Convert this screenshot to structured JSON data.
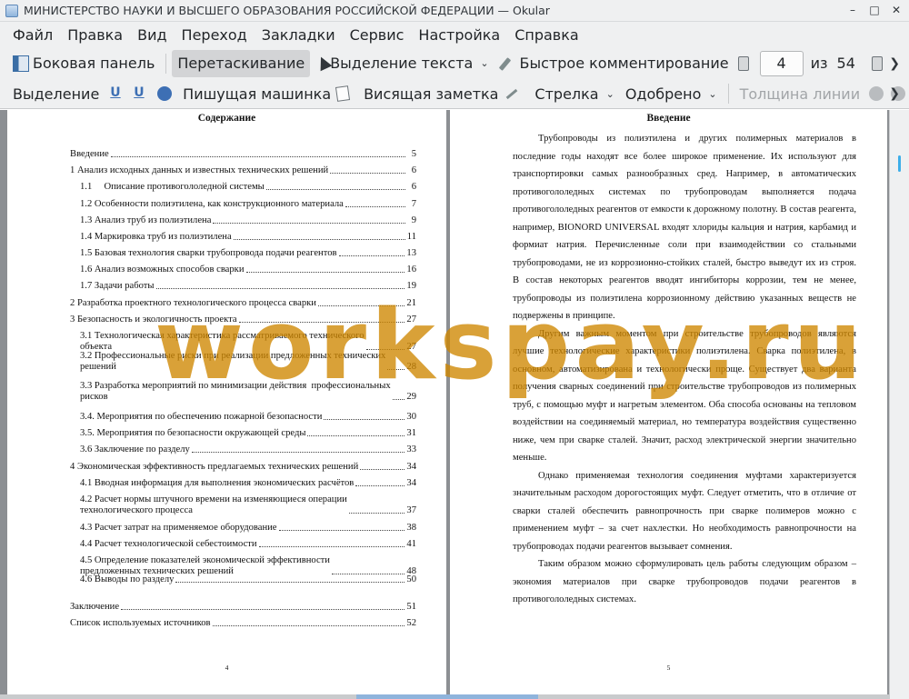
{
  "window": {
    "title": "МИНИСТЕРСТВО НАУКИ И ВЫСШЕГО ОБРАЗОВАНИЯ  РОССИЙСКОЙ ФЕДЕРАЦИИ — Okular",
    "app_icon": "okular-icon",
    "controls": [
      "minimize-icon",
      "maximize-icon",
      "close-icon"
    ]
  },
  "menubar": {
    "items": [
      "Файл",
      "Правка",
      "Вид",
      "Переход",
      "Закладки",
      "Сервис",
      "Настройка",
      "Справка"
    ]
  },
  "toolbar1": {
    "sidebar_label": "Боковая панель",
    "browse_label": "Перетаскивание",
    "text_select_label": "Выделение текста",
    "quick_annot_label": "Быстрое комментирование",
    "page_current": "4",
    "page_of": "из",
    "page_total": "54"
  },
  "toolbar2": {
    "selection_label": "Выделение",
    "typewriter_label": "Пишущая машинка",
    "popup_note_label": "Висящая заметка",
    "arrow_label": "Стрелка",
    "stamp_label": "Одобрено",
    "line_width_label": "Толщина линии"
  },
  "left_page": {
    "heading": "Содержание",
    "page_number": "4",
    "toc": [
      {
        "label": "Введение",
        "page": "5"
      },
      {
        "label": "1 Анализ исходных данных и известных технических решений",
        "page": "6"
      },
      {
        "label": "1.1     Описание противогололедной системы",
        "page": "6"
      },
      {
        "label": "1.2 Особенности полиэтилена, как конструкционного материала",
        "page": "7"
      },
      {
        "label": "1.3 Анализ труб из полиэтилена",
        "page": "9"
      },
      {
        "label": "1.4 Маркировка труб из полиэтилена",
        "page": "11"
      },
      {
        "label": "1.5 Базовая технология сварки трубопровода подачи реагентов",
        "page": "13"
      },
      {
        "label": "1.6 Анализ возможных способов сварки",
        "page": "16"
      },
      {
        "label": "1.7 Задачи работы",
        "page": "19"
      },
      {
        "label": "2 Разработка проектного технологического процесса сварки",
        "page": "21"
      },
      {
        "label": "3 Безопасность и экологичность проекта",
        "page": "27"
      },
      {
        "label": "3.1 Технологическая характеристика рассматриваемого технического\nобъекта",
        "page": "27"
      },
      {
        "label": "3.2 Профессиональные риски при реализации предложенных технических\nрешений",
        "page": "28"
      },
      {
        "label": "3.3 Разработка мероприятий по минимизации действия  профессиональных\nрисков",
        "page": "29"
      },
      {
        "label": "3.4. Мероприятия по обеспечению пожарной безопасности",
        "page": "30"
      },
      {
        "label": "3.5. Мероприятия по безопасности окружающей среды",
        "page": "31"
      },
      {
        "label": "3.6 Заключение по разделу",
        "page": "33"
      },
      {
        "label": "4 Экономическая эффективность предлагаемых технических решений",
        "page": "34"
      },
      {
        "label": "4.1 Вводная информация для выполнения экономических расчётов",
        "page": "34"
      },
      {
        "label": "4.2 Расчет нормы штучного времени на изменяющиеся операции\nтехнологического процесса",
        "page": "37"
      },
      {
        "label": "4.3 Расчет затрат на применяемое оборудование",
        "page": "38"
      },
      {
        "label": "4.4 Расчет технологической себестоимости",
        "page": "41"
      },
      {
        "label": "4.5 Определение показателей экономической эффективности\nпредложенных технических решений",
        "page": "48"
      },
      {
        "label": "4.6 Выводы по разделу",
        "page": "50"
      },
      {
        "label": "Заключение",
        "page": "51"
      },
      {
        "label": "Список используемых источников",
        "page": "52"
      }
    ]
  },
  "right_page": {
    "heading": "Введение",
    "page_number": "5",
    "paragraphs": [
      "Трубопроводы из полиэтилена и других полимерных материалов в последние годы находят все более широкое применение. Их используют для транспортировки самых разнообразных сред. Например, в автоматических противогололедных системах по трубопроводам выполняется подача противогололедных реагентов от емкости к дорожному полотну. В состав реагента, например, BIONORD UNIVERSAL входят хлориды кальция и натрия, карбамид и формиат натрия. Перечисленные соли при взаимодействии со стальными трубопроводами, не из коррозионно-стойких сталей, быстро выведут их из строя. В состав некоторых реагентов вводят ингибиторы коррозии, тем не менее, трубопроводы из полиэтилена коррозионному действию указанных веществ не подвержены в принципе.",
      "Другим важным моментом при строительстве трубопроводов являются лучшие технологические характеристики полиэтилена. Сварка полиэтилена, в основном, автоматизирована и технологически проще. Существует два варианта получения сварных соединений при строительстве трубопроводов из полимерных труб, с помощью муфт и нагретым элементом. Оба способа основаны на тепловом воздействии на соединяемый материал, но температура воздействия существенно ниже, чем при сварке сталей. Значит, расход электрической энергии значительно меньше.",
      "Однако применяемая технология соединения муфтами характеризуется значительным расходом дорогостоящих муфт. Следует отметить, что в отличие от сварки сталей обеспечить равнопрочность при сварке полимеров можно с применением муфт – за счет нахлестки. Но необходимость равнопрочности на трубопроводах подачи реагентов вызывает сомнения.",
      "Таким образом можно сформулировать цель работы следующим образом –экономия материалов при сварке трубопроводов подачи реагентов в противогололедных системах."
    ]
  },
  "watermark": "workspay.ru"
}
